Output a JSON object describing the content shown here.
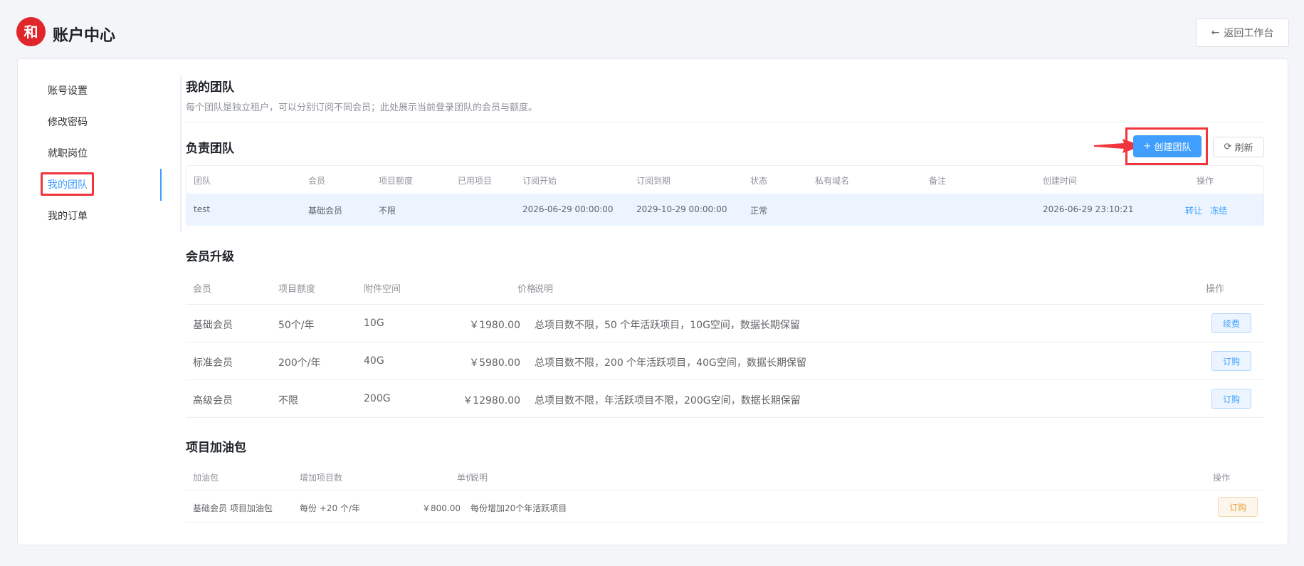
{
  "header": {
    "logo_text": "和",
    "app_title": "账户中心",
    "back_label": "返回工作台"
  },
  "sidebar": {
    "items": [
      {
        "label": "账号设置"
      },
      {
        "label": "修改密码"
      },
      {
        "label": "就职岗位"
      },
      {
        "label": "我的团队"
      },
      {
        "label": "我的订单"
      }
    ],
    "active_index": 3
  },
  "main": {
    "title": "我的团队",
    "description": "每个团队是独立租户，可以分别订阅不同会员；此处展示当前登录团队的会员与额度。"
  },
  "teams": {
    "section_title": "负责团队",
    "create_label": "创建团队",
    "refresh_label": "刷新",
    "columns": [
      "团队",
      "会员",
      "项目额度",
      "已用项目",
      "订阅开始",
      "订阅到期",
      "状态",
      "私有域名",
      "备注",
      "创建时间",
      "操作"
    ],
    "rows": [
      {
        "team": "test",
        "member": "基础会员",
        "quota": "不限",
        "used": "",
        "start": "2026-06-29 00:00:00",
        "end": "2029-10-29 00:00:00",
        "status": "正常",
        "domain": "",
        "remark": "",
        "created": "2026-06-29 23:10:21",
        "actions": [
          "转让",
          "冻结"
        ]
      }
    ]
  },
  "membership": {
    "section_title": "会员升级",
    "columns": [
      "会员",
      "项目额度",
      "附件空间",
      "价格",
      "说明",
      "操作"
    ],
    "rows": [
      {
        "name": "基础会员",
        "quota": "50个/年",
        "space": "10G",
        "price": "￥1980.00",
        "desc": "总项目数不限，50 个年活跃项目，10G空间，数据长期保留",
        "action": "续费"
      },
      {
        "name": "标准会员",
        "quota": "200个/年",
        "space": "40G",
        "price": "￥5980.00",
        "desc": "总项目数不限，200 个年活跃项目，40G空间，数据长期保留",
        "action": "订购"
      },
      {
        "name": "高级会员",
        "quota": "不限",
        "space": "200G",
        "price": "￥12980.00",
        "desc": "总项目数不限，年活跃项目不限，200G空间，数据长期保留",
        "action": "订购"
      }
    ]
  },
  "addon": {
    "section_title": "项目加油包",
    "columns": [
      "加油包",
      "增加项目数",
      "单价",
      "说明",
      "操作"
    ],
    "rows": [
      {
        "name": "基础会员 项目加油包",
        "count": "每份 +20 个/年",
        "price": "￥800.00",
        "desc": "每份增加20个年活跃项目",
        "action": "订购"
      }
    ]
  },
  "colors": {
    "primary": "#409eff",
    "highlight": "#f0353d",
    "brand": "#e0262b",
    "warning": "#e6a23c"
  }
}
